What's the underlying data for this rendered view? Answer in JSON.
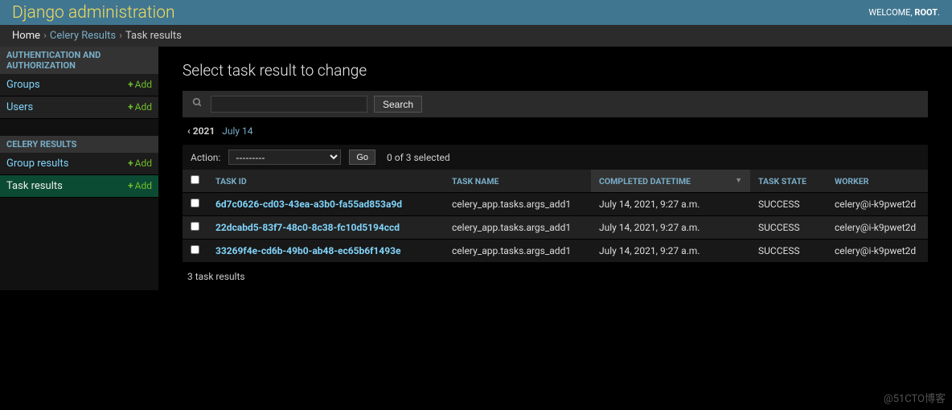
{
  "header": {
    "site_name": "Django administration",
    "welcome": "WELCOME,",
    "username": "ROOT"
  },
  "breadcrumbs": {
    "home": "Home",
    "app": "Celery Results",
    "model": "Task results",
    "sep": "›"
  },
  "sidebar": {
    "apps": [
      {
        "name": "AUTHENTICATION AND AUTHORIZATION",
        "models": [
          {
            "label": "Groups",
            "add": "Add"
          },
          {
            "label": "Users",
            "add": "Add"
          }
        ]
      },
      {
        "name": "CELERY RESULTS",
        "models": [
          {
            "label": "Group results",
            "add": "Add"
          },
          {
            "label": "Task results",
            "add": "Add",
            "current": true
          }
        ]
      }
    ]
  },
  "content": {
    "title": "Select task result to change"
  },
  "toolbar": {
    "search_button": "Search"
  },
  "date_hierarchy": {
    "back": "‹ 2021",
    "current": "July 14"
  },
  "actions": {
    "label": "Action:",
    "selected_option": "---------",
    "go": "Go",
    "selection_text": "0 of 3 selected"
  },
  "columns": {
    "id": "TASK ID",
    "name": "TASK NAME",
    "datetime": "COMPLETED DATETIME",
    "state": "TASK STATE",
    "worker": "WORKER"
  },
  "rows": [
    {
      "id": "6d7c0626-cd03-43ea-a3b0-fa55ad853a9d",
      "name": "celery_app.tasks.args_add1",
      "dt": "July 14, 2021, 9:27 a.m.",
      "state": "SUCCESS",
      "worker": "celery@i-k9pwet2d"
    },
    {
      "id": "22dcabd5-83f7-48c0-8c38-fc10d5194ccd",
      "name": "celery_app.tasks.args_add1",
      "dt": "July 14, 2021, 9:27 a.m.",
      "state": "SUCCESS",
      "worker": "celery@i-k9pwet2d"
    },
    {
      "id": "33269f4e-cd6b-49b0-ab48-ec65b6f1493e",
      "name": "celery_app.tasks.args_add1",
      "dt": "July 14, 2021, 9:27 a.m.",
      "state": "SUCCESS",
      "worker": "celery@i-k9pwet2d"
    }
  ],
  "paginator": {
    "text": "3 task results"
  },
  "watermark": "@51CTO博客"
}
